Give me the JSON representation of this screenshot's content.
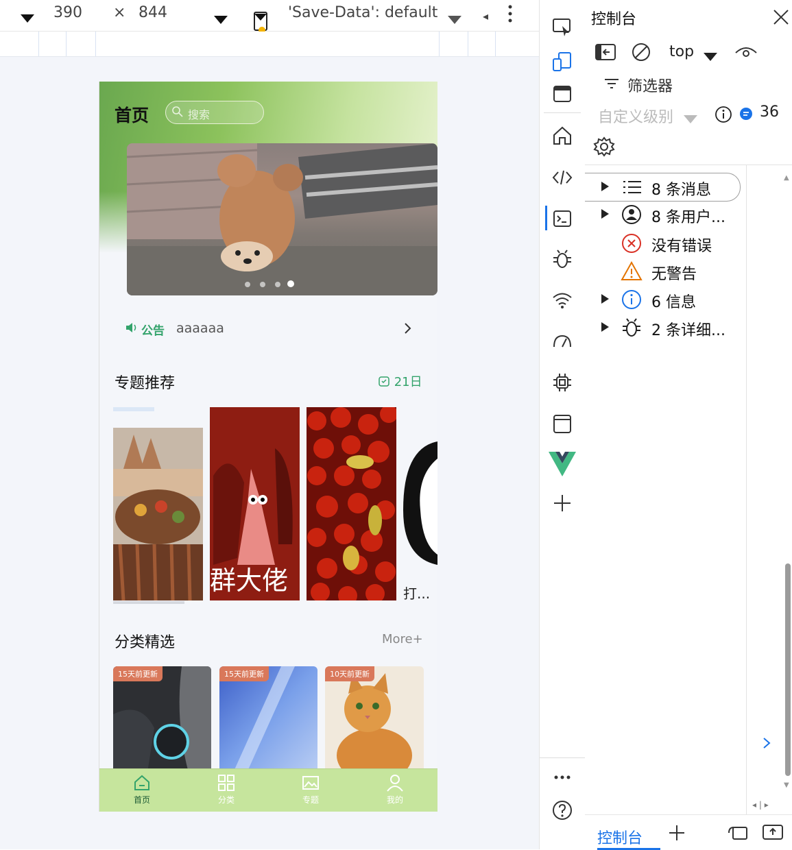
{
  "device_toolbar": {
    "width": "390",
    "times": "×",
    "height": "844",
    "save_data": "'Save-Data': default"
  },
  "phone": {
    "header": {
      "title": "首页",
      "search_placeholder": "搜索"
    },
    "notice": {
      "label": "公告",
      "text": "aaaaaa"
    },
    "section_topics": {
      "title": "专题推荐",
      "date": "21日",
      "item_texts": [
        "群大佬",
        "打..."
      ]
    },
    "section_categories": {
      "title": "分类精选",
      "more": "More+",
      "items": [
        {
          "badge": "15天前更新"
        },
        {
          "badge": "15天前更新"
        },
        {
          "badge": "10天前更新"
        }
      ]
    },
    "tabbar": [
      {
        "label": "首页",
        "icon": "home-icon"
      },
      {
        "label": "分类",
        "icon": "grid-icon"
      },
      {
        "label": "专题",
        "icon": "image-icon"
      },
      {
        "label": "我的",
        "icon": "user-icon"
      }
    ]
  },
  "devtools": {
    "title": "控制台",
    "context": "top",
    "filter_placeholder": "筛选器",
    "levels": "自定义级别",
    "issue_count": "36",
    "tree": [
      {
        "label": "8 条消息",
        "icon": "list-icon",
        "expandable": true
      },
      {
        "label": "8 条用户...",
        "icon": "user-circle-icon",
        "expandable": true
      },
      {
        "label": "没有错误",
        "icon": "error-icon",
        "expandable": false
      },
      {
        "label": "无警告",
        "icon": "warning-icon",
        "expandable": false
      },
      {
        "label": "6 信息",
        "icon": "info-icon",
        "expandable": true
      },
      {
        "label": "2 条详细...",
        "icon": "bug-icon",
        "expandable": true
      }
    ],
    "bottom_tab": "控制台"
  },
  "colors": {
    "accent_green": "#33a36b",
    "devtools_blue": "#1a73e8",
    "tabbar_bg": "#c6e59d"
  }
}
